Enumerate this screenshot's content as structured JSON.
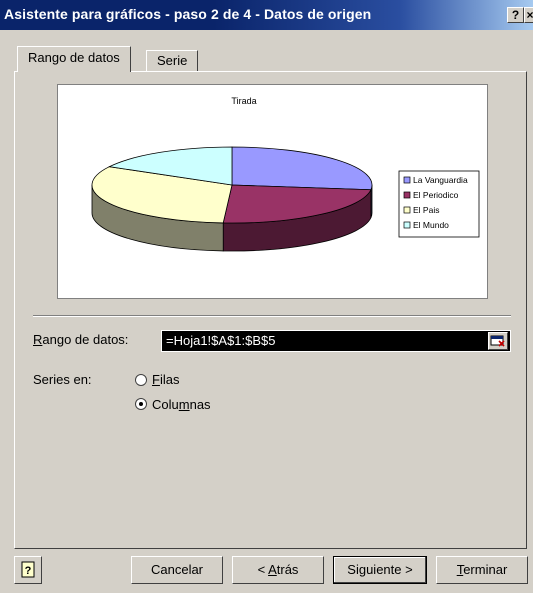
{
  "window": {
    "title": "Asistente para gráficos - paso 2 de 4 - Datos de origen",
    "help_button": "?",
    "close_button": "×"
  },
  "tabs": [
    {
      "label": "Rango de datos",
      "active": true
    },
    {
      "label": "Serie",
      "active": false
    }
  ],
  "chart_data": {
    "type": "pie",
    "style": "3d-exploded",
    "title": "Tirada",
    "categories": [
      "La Vanguardia",
      "El Periodico",
      "El Pais",
      "El Mundo"
    ],
    "values": [
      27,
      24,
      32,
      17
    ],
    "colors": [
      "#9999ff",
      "#993366",
      "#ffffcc",
      "#ccffff"
    ],
    "side_colors": [
      "#4c4c80",
      "#4c1933",
      "#80806a",
      "#668080"
    ],
    "legend_position": "right"
  },
  "range": {
    "label_prefix": "R",
    "label_rest": "ango de datos:",
    "value": "=Hoja1!$A$1:$B$5"
  },
  "series_in": {
    "label": "Series en:",
    "options": [
      {
        "ul": "F",
        "rest": "ilas",
        "checked": false
      },
      {
        "pre": "Colu",
        "ul": "m",
        "rest": "nas",
        "checked": true
      }
    ]
  },
  "buttons": {
    "help_icon": "?",
    "cancel": "Cancelar",
    "back_pre": "< ",
    "back_ul": "A",
    "back_rest": "trás",
    "next": "Siguiente >",
    "finish_ul": "T",
    "finish_rest": "erminar"
  }
}
